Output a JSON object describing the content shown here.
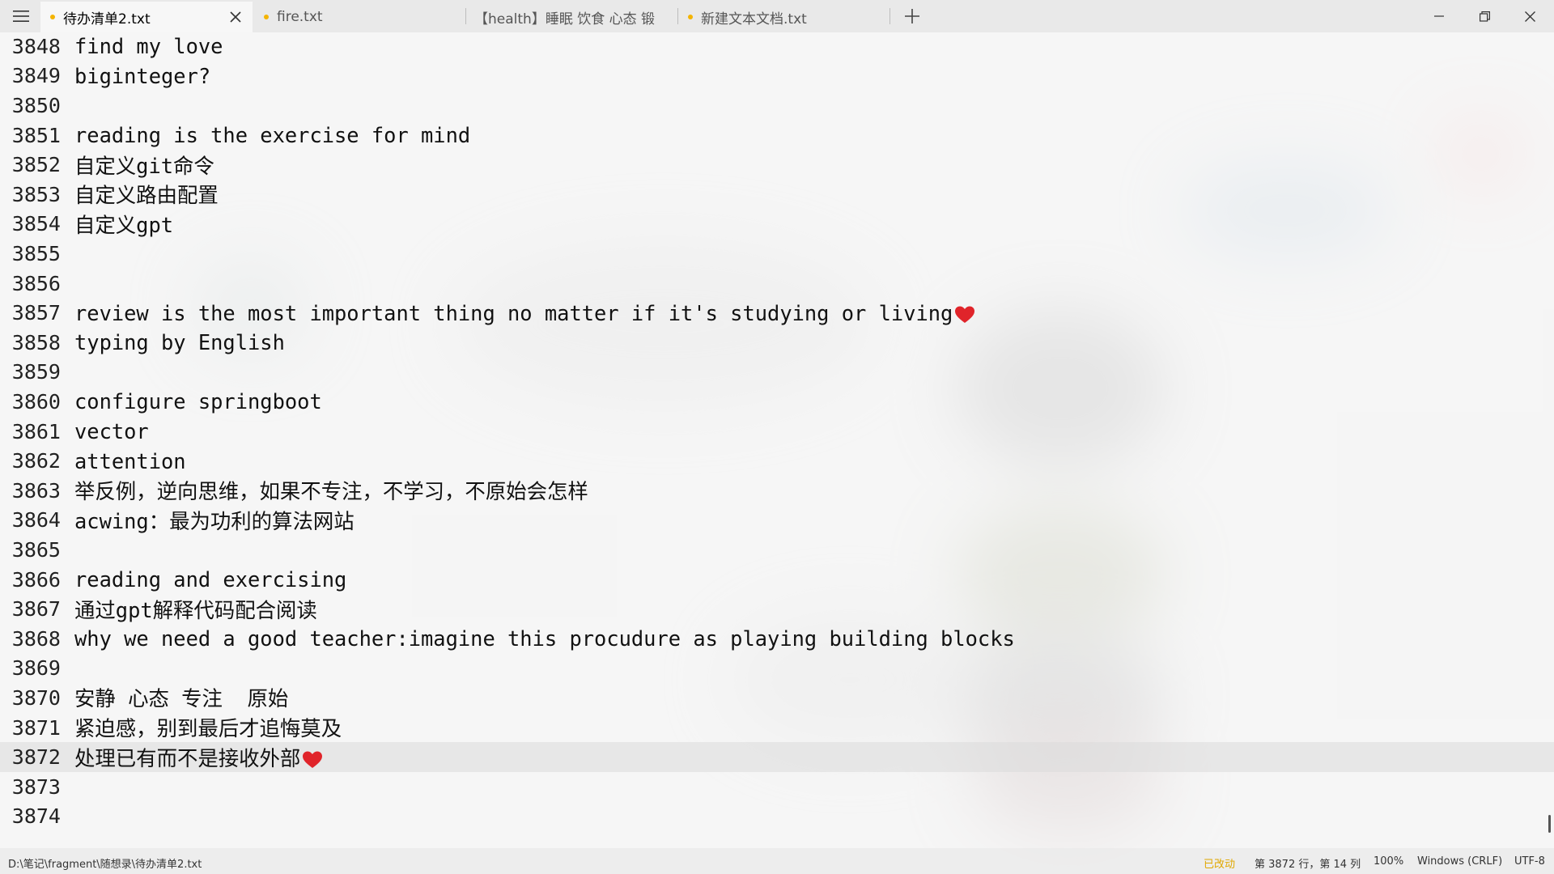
{
  "tabs": [
    {
      "label": "待办清单2.txt",
      "modified": true,
      "active": true
    },
    {
      "label": "fire.txt",
      "modified": true,
      "active": false
    },
    {
      "label": "【health】睡眠 饮食 心态 锻",
      "modified": false,
      "active": false
    },
    {
      "label": "新建文本文档.txt",
      "modified": true,
      "active": false
    }
  ],
  "editor": {
    "current_line": "3872",
    "lines": [
      {
        "n": "3848",
        "t": "find my love"
      },
      {
        "n": "3849",
        "t": "biginteger?"
      },
      {
        "n": "3850",
        "t": ""
      },
      {
        "n": "3851",
        "t": "reading is the exercise for mind"
      },
      {
        "n": "3852",
        "t": "自定义git命令"
      },
      {
        "n": "3853",
        "t": "自定义路由配置"
      },
      {
        "n": "3854",
        "t": "自定义gpt"
      },
      {
        "n": "3855",
        "t": ""
      },
      {
        "n": "3856",
        "t": ""
      },
      {
        "n": "3857",
        "t": "review is the most important thing no matter if it's studying or living",
        "heart": true
      },
      {
        "n": "3858",
        "t": "typing by English"
      },
      {
        "n": "3859",
        "t": ""
      },
      {
        "n": "3860",
        "t": "configure springboot"
      },
      {
        "n": "3861",
        "t": "vector"
      },
      {
        "n": "3862",
        "t": "attention"
      },
      {
        "n": "3863",
        "t": "举反例，逆向思维，如果不专注，不学习，不原始会怎样"
      },
      {
        "n": "3864",
        "t": "acwing：最为功利的算法网站"
      },
      {
        "n": "3865",
        "t": ""
      },
      {
        "n": "3866",
        "t": "reading and exercising"
      },
      {
        "n": "3867",
        "t": "通过gpt解释代码配合阅读"
      },
      {
        "n": "3868",
        "t": "why we need a good teacher:imagine this procudure as playing building blocks"
      },
      {
        "n": "3869",
        "t": ""
      },
      {
        "n": "3870",
        "t": "安静 心态 专注  原始"
      },
      {
        "n": "3871",
        "t": "紧迫感，别到最后才追悔莫及"
      },
      {
        "n": "3872",
        "t": "处理已有而不是接收外部",
        "heart": true
      },
      {
        "n": "3873",
        "t": ""
      },
      {
        "n": "3874",
        "t": ""
      }
    ]
  },
  "status": {
    "path": "D:\\笔记\\fragment\\随想录\\待办清单2.txt",
    "modified_label": "已改动",
    "position": "第 3872 行，第 14 列",
    "zoom": "100%",
    "line_ending": "Windows (CRLF)",
    "encoding": "UTF-8"
  },
  "colors": {
    "modified_dot": "#f4b400",
    "modified_status": "#e0a800",
    "heart": "#e0242a"
  },
  "icons": {
    "menu": "hamburger-icon",
    "tab_close": "close-icon",
    "add_tab": "plus-icon",
    "minimize": "minimize-icon",
    "restore": "restore-icon",
    "close_window": "close-icon",
    "heart": "red-heart-emoji"
  }
}
